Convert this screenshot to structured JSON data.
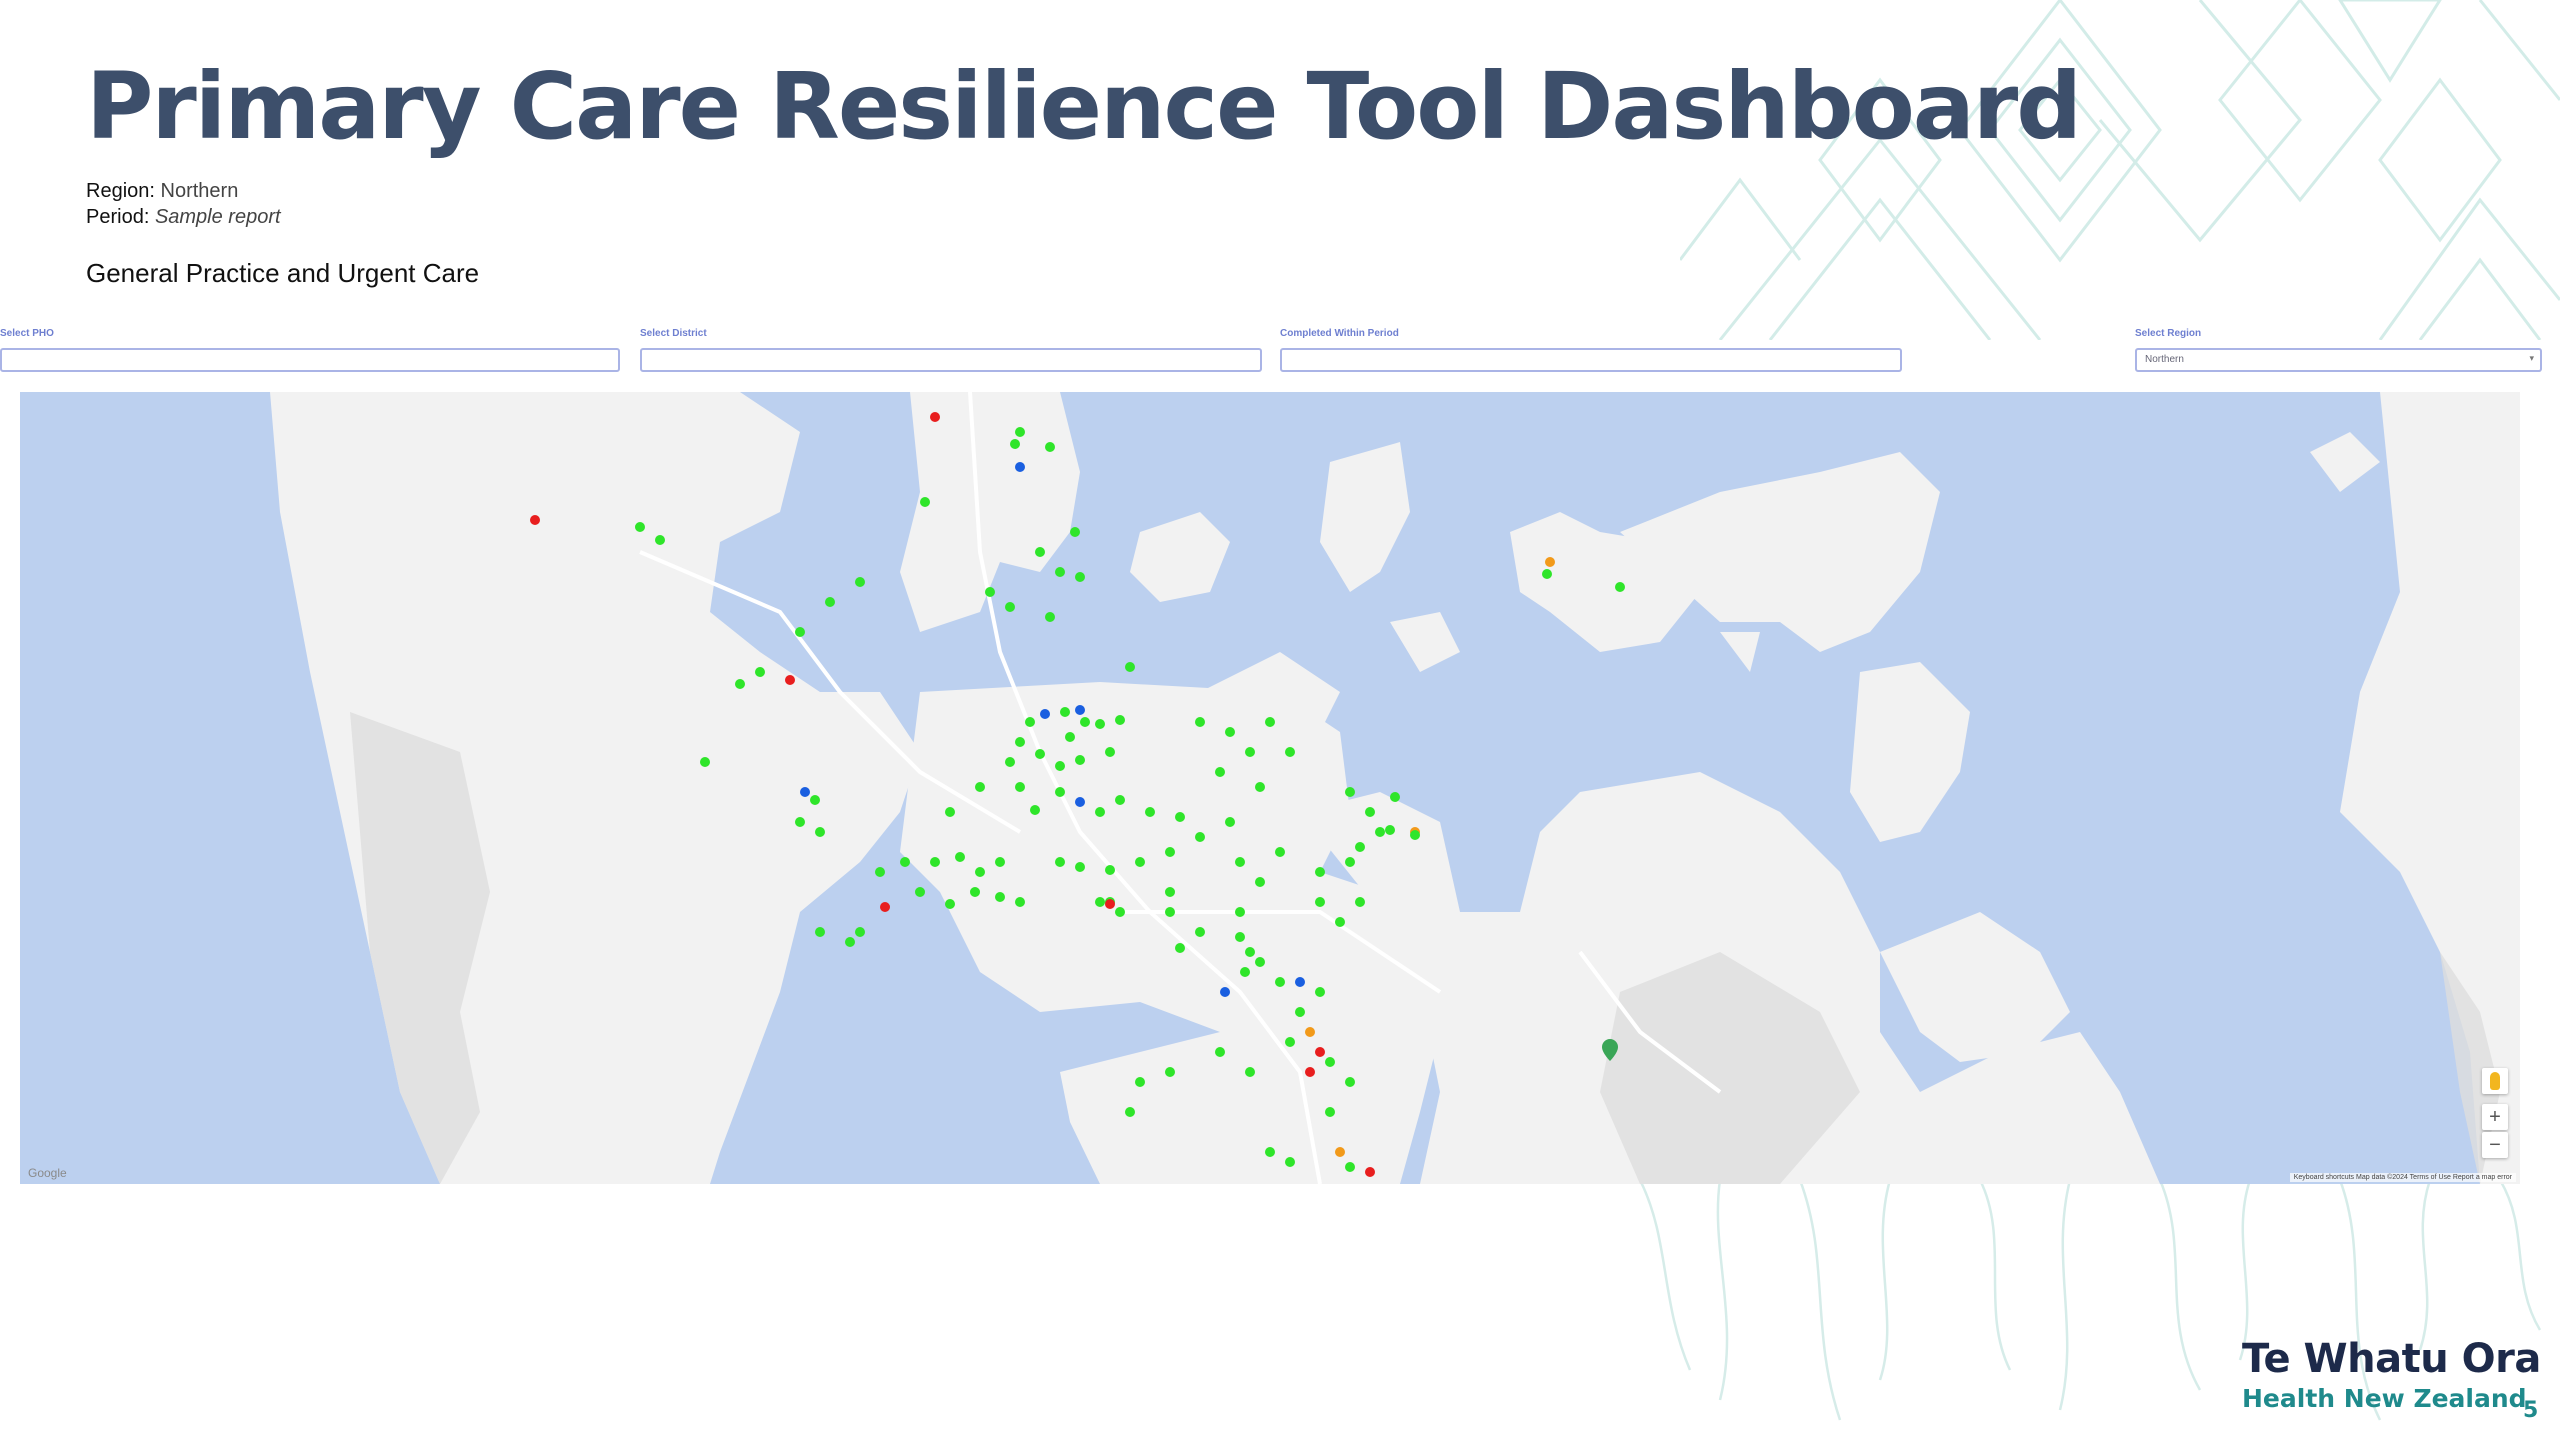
{
  "slide": {
    "title": "Primary Care Resilience Tool Dashboard",
    "region_label": "Region:",
    "region_value": "Northern",
    "period_label": "Period:",
    "period_value": "Sample report",
    "section_heading": "General Practice and Urgent Care",
    "page_number": "5"
  },
  "filters": {
    "pho_label": "Select PHO",
    "district_label": "Select District",
    "period_label": "Completed Within Period",
    "region_label": "Select Region",
    "region_selected": "Northern"
  },
  "map": {
    "zoom_in": "+",
    "zoom_out": "−",
    "watermark": "Google",
    "attribution": "Keyboard shortcuts   Map data ©2024   Terms of Use   Report a map error",
    "marker_colors": {
      "green": "#2fe52a",
      "red": "#e81e1e",
      "blue": "#1a5fe0",
      "orange": "#f29a1a"
    }
  },
  "brand": {
    "logo_line1": "Te Whatu Ora",
    "logo_line2": "Health New Zealand",
    "navy": "#1d2a4a",
    "teal": "#1f8a8c",
    "title_color": "#3d4f6b"
  }
}
